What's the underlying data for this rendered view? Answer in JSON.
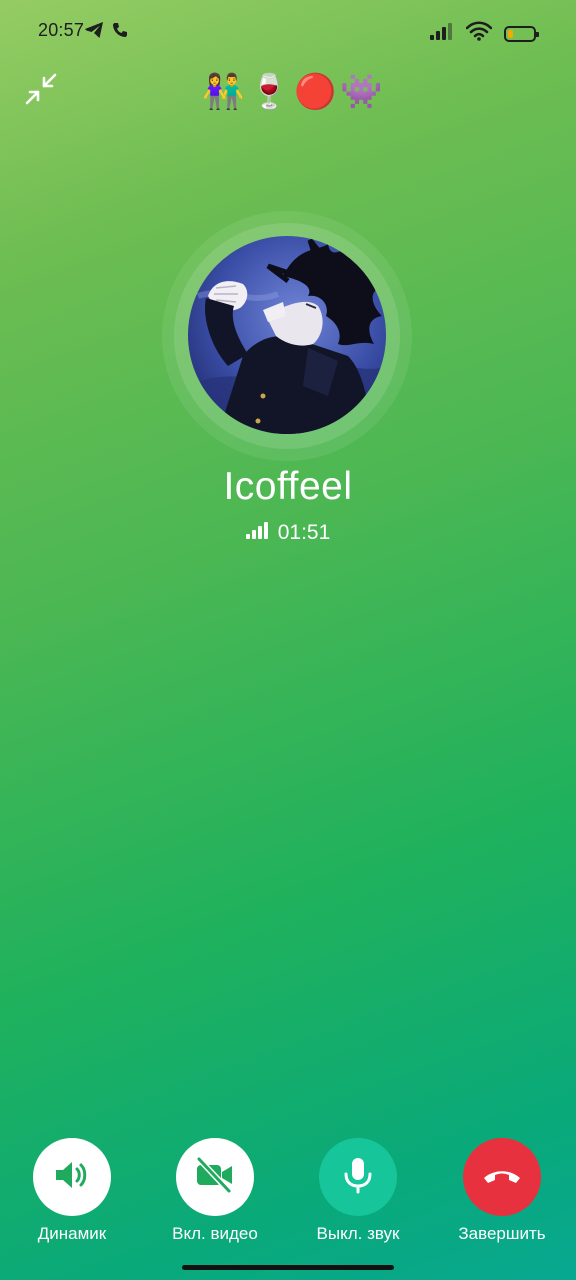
{
  "status_bar": {
    "time": "20:57",
    "left_icons": [
      "telegram-icon",
      "phone-icon"
    ],
    "right_icons": [
      "signal-icon",
      "wifi-icon",
      "battery-icon"
    ],
    "battery_level": 0.2,
    "battery_color": "#f2a900"
  },
  "header": {
    "minimize_icon": "minimize-arrows-icon",
    "emojis": [
      "👫",
      "🍷",
      "🔴",
      "👾"
    ]
  },
  "call": {
    "caller_name": "Icoffeel",
    "duration": "01:51",
    "signal_icon": "signal-strength-icon"
  },
  "controls": [
    {
      "label": "Динамик",
      "icon": "speaker-icon",
      "bg": "#ffffff",
      "icon_color": "#1faa5d"
    },
    {
      "label": "Вкл. видео",
      "icon": "video-off-icon",
      "bg": "#ffffff",
      "icon_color": "#1faa5d"
    },
    {
      "label": "Выкл. звук",
      "icon": "microphone-icon",
      "bg": "#16c69a",
      "icon_color": "#ffffff"
    },
    {
      "label": "Завершить",
      "icon": "end-call-icon",
      "bg": "#e8313f",
      "icon_color": "#ffffff"
    }
  ],
  "colors": {
    "gradient_top": "#95cc63",
    "gradient_bottom": "#07a891",
    "end_call": "#e8313f",
    "mute": "#16c69a"
  }
}
